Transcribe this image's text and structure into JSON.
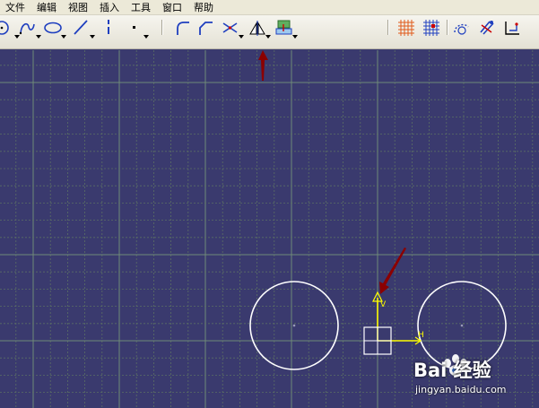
{
  "menu": {
    "items": [
      {
        "label": "文件"
      },
      {
        "label": "编辑"
      },
      {
        "label": "视图"
      },
      {
        "label": "插入"
      },
      {
        "label": "工具"
      },
      {
        "label": "窗口"
      },
      {
        "label": "帮助"
      }
    ]
  },
  "toolbar": {
    "tools": [
      {
        "icon": "circle-tool-icon",
        "dropdown": true
      },
      {
        "icon": "spline-tool-icon",
        "dropdown": true
      },
      {
        "icon": "ellipse-tool-icon",
        "dropdown": true
      },
      {
        "icon": "line-tool-icon",
        "dropdown": true
      },
      {
        "icon": "axis-tool-icon",
        "dropdown": false
      },
      {
        "icon": "point-tool-icon",
        "dropdown": true
      },
      {
        "icon": "corner-tool-icon",
        "dropdown": false
      },
      {
        "icon": "chamfer-tool-icon",
        "dropdown": false
      },
      {
        "icon": "trim-tool-icon",
        "dropdown": true
      },
      {
        "icon": "mirror-tool-icon",
        "dropdown": true
      },
      {
        "icon": "project-3d-elements-icon",
        "dropdown": true
      },
      {
        "icon": "grid-icon",
        "dropdown": false
      },
      {
        "icon": "snap-to-point-icon",
        "dropdown": false
      },
      {
        "icon": "construction-element-icon",
        "dropdown": false
      },
      {
        "icon": "geometrical-constraints-icon",
        "dropdown": false
      },
      {
        "icon": "dimensional-constraints-icon",
        "dropdown": false
      }
    ]
  },
  "colors": {
    "canvas_background": "#3a3a6e",
    "grid_minor": "#5b6e64",
    "grid_major": "#6f8a78",
    "sketch_geometry": "#ffffff",
    "axis_color": "#ffff00",
    "annotation_arrow": "#8b0000"
  },
  "canvas": {
    "axis_labels": {
      "v": "V",
      "h": "H"
    },
    "elements": [
      "circle-left",
      "circle-right",
      "origin-axis"
    ]
  },
  "watermark": {
    "brand": "Bai 经验",
    "url": "jingyan.baidu.com"
  }
}
